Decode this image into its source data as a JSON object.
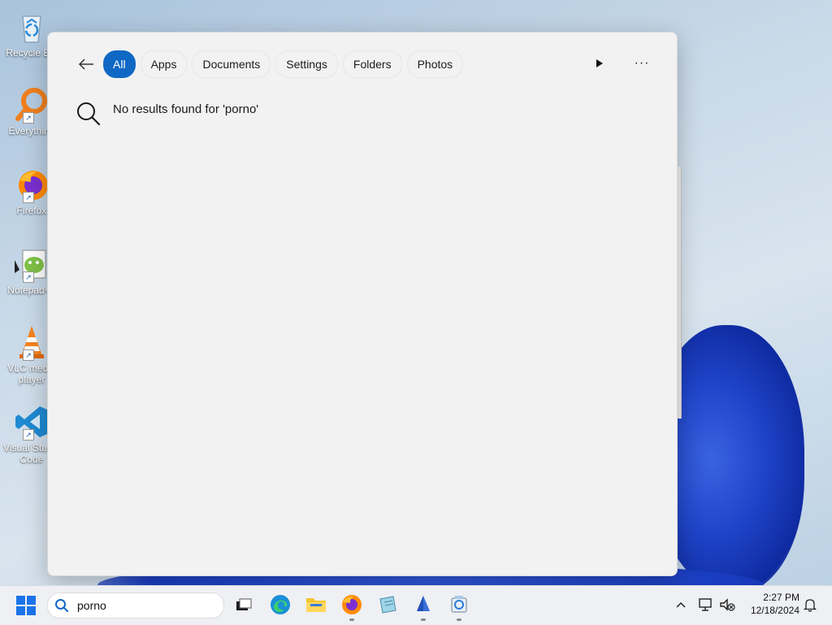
{
  "desktop": {
    "icons": [
      {
        "label": "Recycle Bin",
        "icon": "recycle-bin-icon"
      },
      {
        "label": "Everything",
        "icon": "everything-icon"
      },
      {
        "label": "Firefox",
        "icon": "firefox-icon"
      },
      {
        "label": "Notepad++",
        "icon": "notepad-plus-plus-icon"
      },
      {
        "label": "VLC media player",
        "icon": "vlc-icon"
      },
      {
        "label": "Visual Studio Code",
        "icon": "vscode-icon"
      }
    ]
  },
  "search_panel": {
    "tabs": [
      {
        "label": "All",
        "active": true
      },
      {
        "label": "Apps",
        "active": false
      },
      {
        "label": "Documents",
        "active": false
      },
      {
        "label": "Settings",
        "active": false
      },
      {
        "label": "Folders",
        "active": false
      },
      {
        "label": "Photos",
        "active": false
      }
    ],
    "more_label": "···",
    "no_results_message": "No results found for 'porno'"
  },
  "taskbar": {
    "search_value": "porno",
    "apps": [
      "task-view-icon",
      "edge-icon",
      "file-explorer-icon",
      "firefox-icon",
      "notepad-icon",
      "app-sail-icon",
      "app-misc-icon"
    ],
    "clock": {
      "time": "2:27 PM",
      "date": "12/18/2024"
    }
  },
  "colors": {
    "accent": "#0f68c4",
    "start": "#1a73e8"
  }
}
